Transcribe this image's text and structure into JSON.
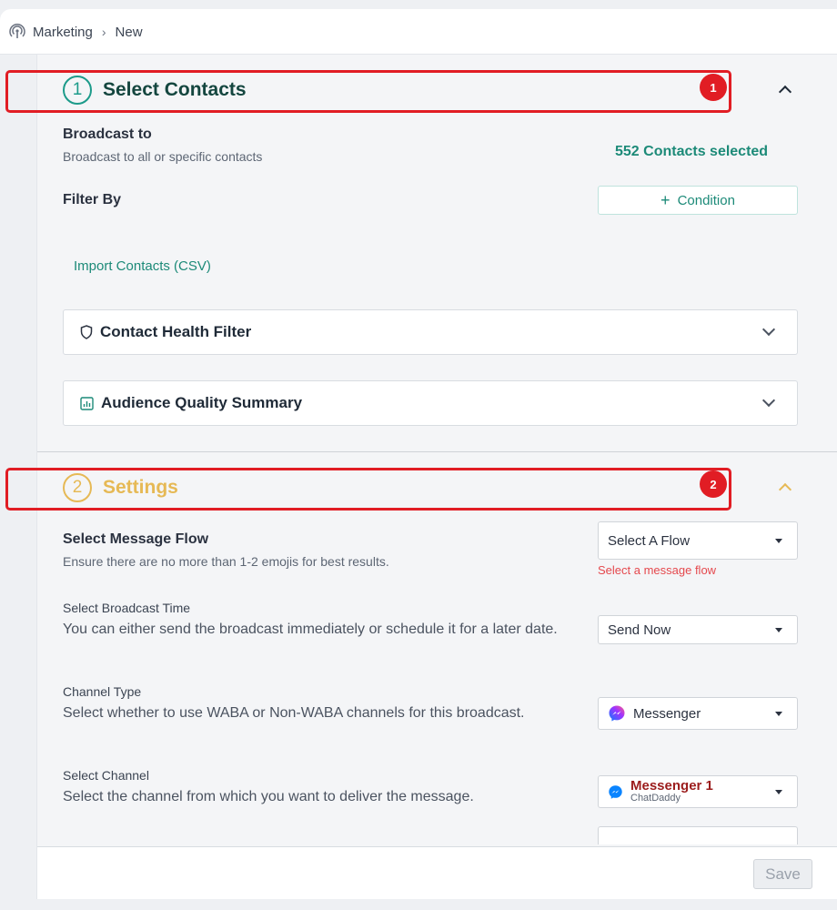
{
  "breadcrumb": {
    "root": "Marketing",
    "current": "New",
    "icon": "broadcast-icon"
  },
  "annotations": [
    "1",
    "2"
  ],
  "select_contacts": {
    "title": "Select Contacts",
    "step": "1",
    "broadcast_to": {
      "label": "Broadcast to",
      "description": "Broadcast to all or specific contacts"
    },
    "contacts_selected": "552 Contacts selected",
    "filter_by": "Filter By",
    "condition_button": "Condition",
    "import_link": "Import Contacts (CSV)",
    "contact_health_filter": "Contact Health Filter",
    "audience_quality_summary": "Audience Quality Summary"
  },
  "settings": {
    "title": "Settings",
    "step": "2",
    "message_flow": {
      "label": "Select Message Flow",
      "description": "Ensure there are no more than 1-2 emojis for best results.",
      "value": "Select A Flow",
      "error": "Select a message flow"
    },
    "broadcast_time": {
      "label": "Select Broadcast Time",
      "description": "You can either send the broadcast immediately or schedule it for a later date.",
      "value": "Send Now"
    },
    "channel_type": {
      "label": "Channel Type",
      "description": "Select whether to use WABA or Non-WABA channels for this broadcast.",
      "value": "Messenger"
    },
    "channel": {
      "label": "Select Channel",
      "description": "Select the channel from which you want to deliver the message.",
      "value": "Messenger 1",
      "sub": "ChatDaddy"
    }
  },
  "footer": {
    "save_label": "Save"
  },
  "colors": {
    "accent": "#1c8a78",
    "settings_accent": "#e6b955",
    "annotation": "#e11d24",
    "error": "#e5484d"
  }
}
